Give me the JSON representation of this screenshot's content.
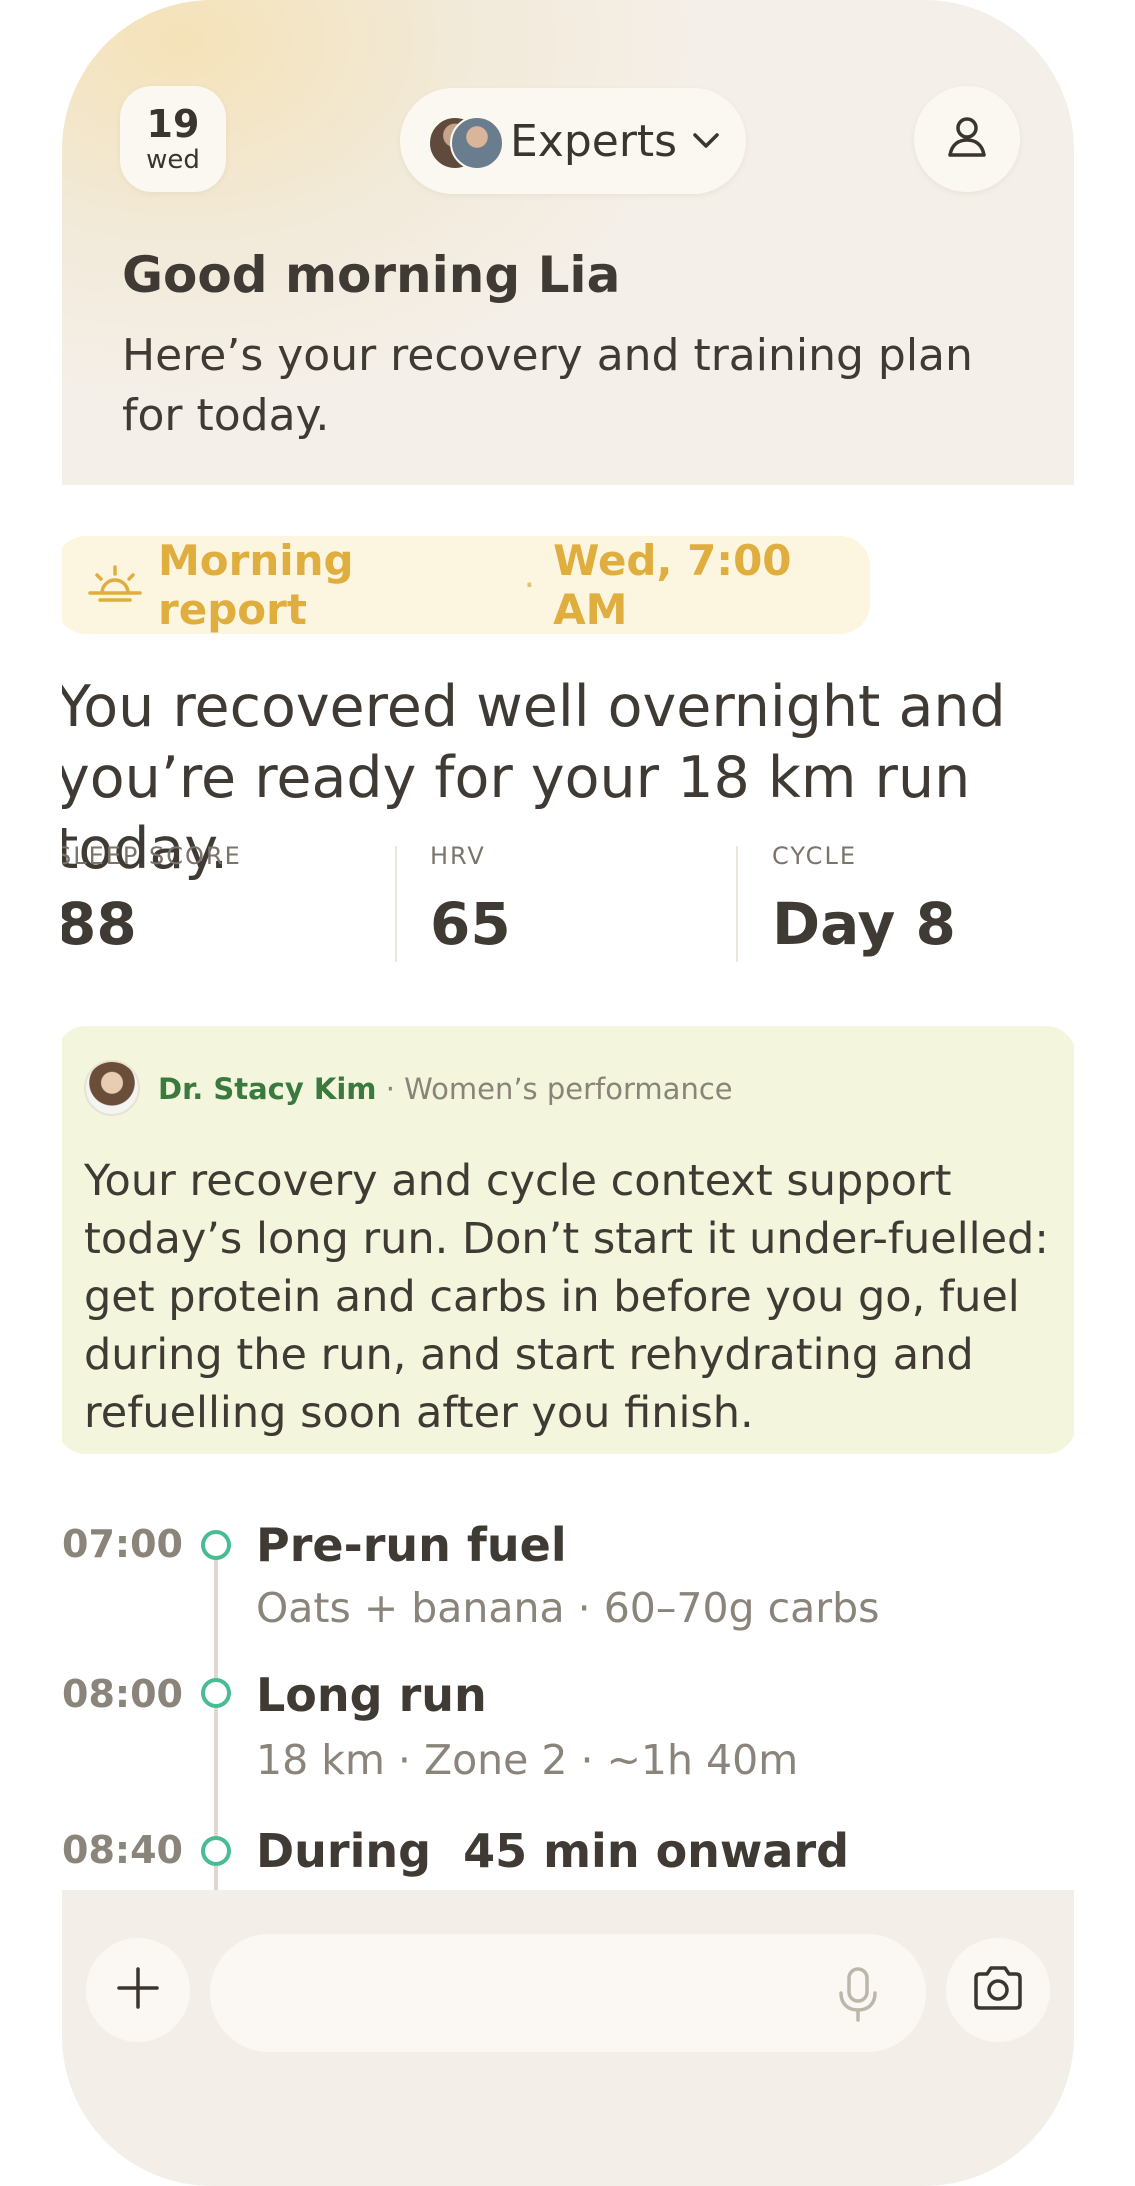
{
  "header": {
    "date_number": "19",
    "date_day": "wed",
    "experts_label": "Experts",
    "greeting": "Good morning Lia",
    "subgreeting": "Here’s your recovery and training plan for today."
  },
  "report": {
    "label": "Morning report",
    "separator": "·",
    "time": "Wed, 7:00 AM",
    "headline": "You recovered well overnight and you’re ready for your 18 km run today."
  },
  "stats": [
    {
      "label": "SLEEP SCORE",
      "value": "88"
    },
    {
      "label": "HRV",
      "value": "65"
    },
    {
      "label": "CYCLE",
      "value": "Day 8"
    }
  ],
  "expert_card": {
    "name": "Dr. Stacy Kim",
    "role": " · Women’s performance",
    "message": "Your recovery and cycle context support today’s long run. Don’t start it under-fuelled: get protein and carbs in before you go, fuel during the run, and start rehydrating and refuelling soon after you finish."
  },
  "timeline": [
    {
      "time": "07:00",
      "title": "Pre-run fuel",
      "subtitle": "Oats + banana · 60–70g carbs"
    },
    {
      "time": "08:00",
      "title": "Long run",
      "subtitle": "18 km · Zone 2 · ~1h 40m"
    },
    {
      "time": "08:40",
      "title": "During  45 min onward",
      "subtitle": ""
    }
  ],
  "composer": {
    "placeholder": ""
  },
  "colors": {
    "accent_gold": "#e0ae3e",
    "accent_green": "#3b7a3f",
    "timeline_dot": "#49bc94",
    "card_bg": "#f3f6dc"
  },
  "icons": [
    "sunrise-icon",
    "chevron-down-icon",
    "person-icon",
    "plus-icon",
    "microphone-icon",
    "camera-icon"
  ]
}
